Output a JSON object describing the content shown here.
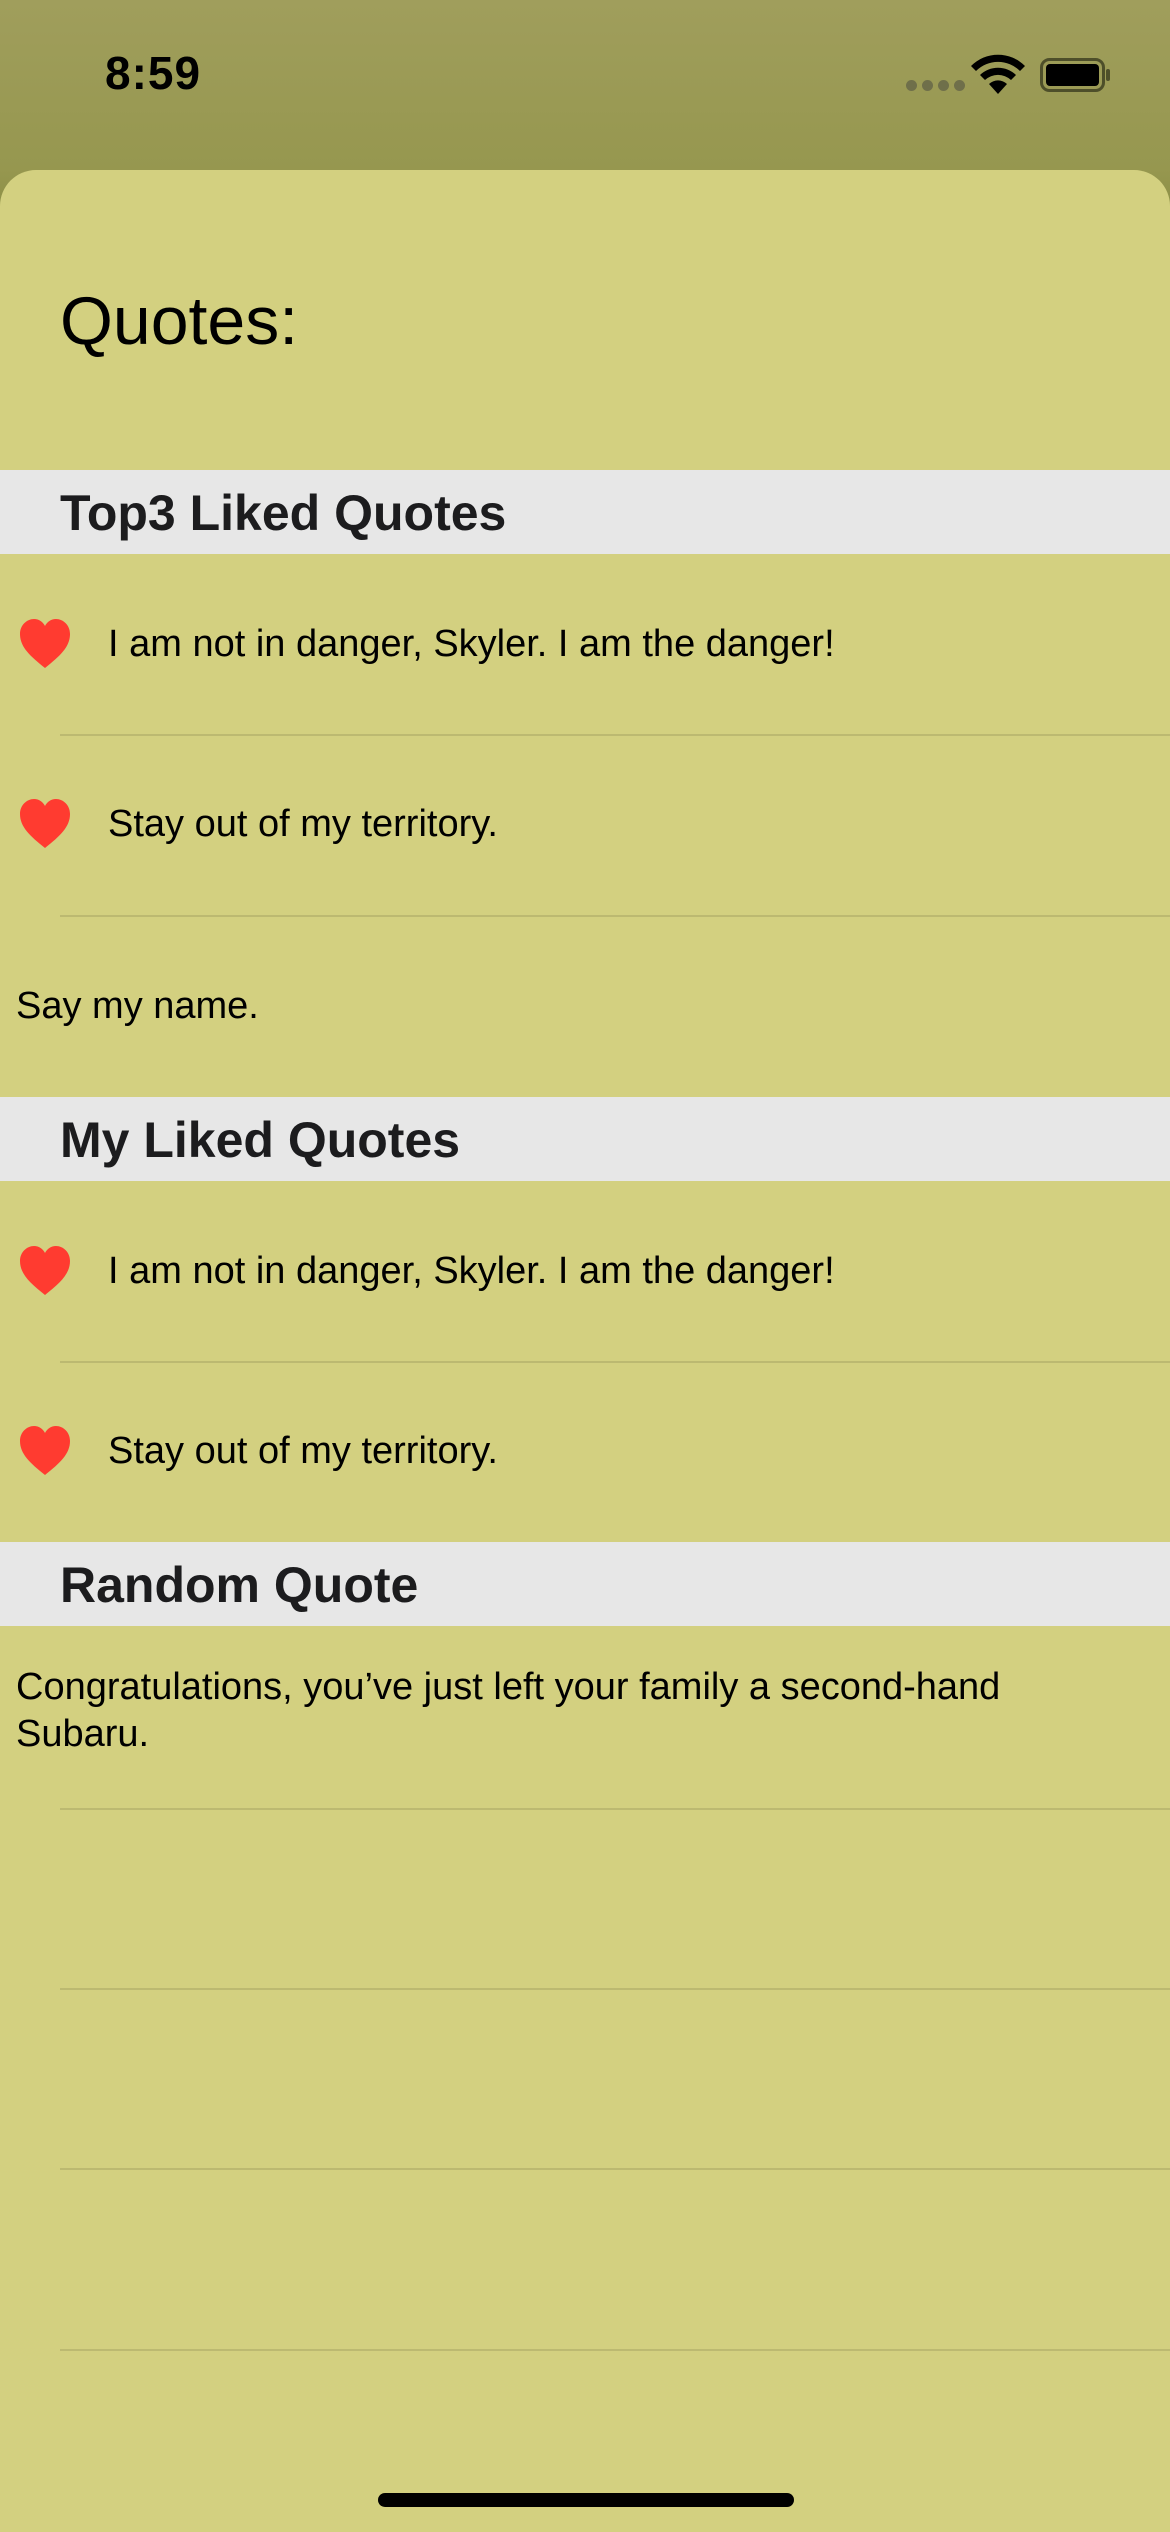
{
  "status": {
    "time": "8:59"
  },
  "page": {
    "title": "Quotes:"
  },
  "sections": {
    "top3": {
      "header": "Top3 Liked Quotes",
      "items": [
        {
          "text": "I am not in danger, Skyler. I am the danger!",
          "liked": true
        },
        {
          "text": "Stay out of my territory.",
          "liked": true
        },
        {
          "text": "Say my name.",
          "liked": false
        }
      ]
    },
    "liked": {
      "header": "My Liked Quotes",
      "items": [
        {
          "text": "I am not in danger, Skyler. I am the danger!",
          "liked": true
        },
        {
          "text": "Stay out of my territory.",
          "liked": true
        }
      ]
    },
    "random": {
      "header": "Random Quote",
      "text": "Congratulations, you’ve just left your family a second-hand Subaru."
    }
  },
  "colors": {
    "sheet": "#d3d080",
    "header_bg": "#e7e7e7",
    "heart": "#ff3b30"
  },
  "icons": {
    "like": "heart-icon"
  }
}
